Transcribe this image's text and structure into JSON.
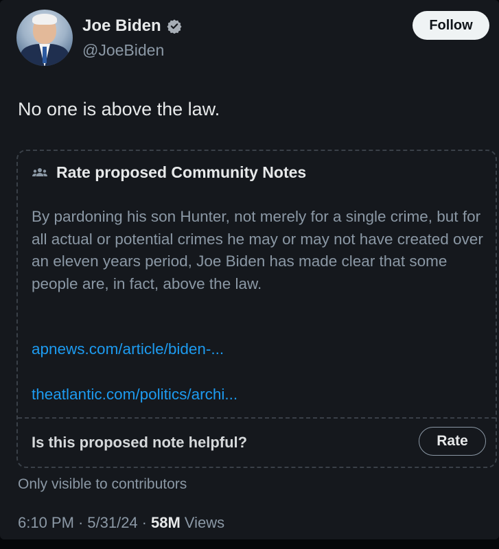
{
  "author": {
    "name": "Joe Biden",
    "handle": "@JoeBiden",
    "verified_icon": "verified-badge-icon",
    "avatar": "profile-photo"
  },
  "follow_label": "Follow",
  "tweet": {
    "text": "No one is above the law."
  },
  "community_notes": {
    "icon": "people-icon",
    "title": "Rate proposed Community Notes",
    "body": "By pardoning his son Hunter, not merely for a single crime, but for all actual or potential crimes he may or may not have created over an eleven years period, Joe Biden has made clear that some people are, in fact, above the law.",
    "links": [
      "apnews.com/article/biden-...",
      "theatlantic.com/politics/archi..."
    ],
    "helpful_question": "Is this proposed note helpful?",
    "rate_label": "Rate"
  },
  "visibility_note": "Only visible to contributors",
  "meta": {
    "time": "6:10 PM",
    "separator": "·",
    "date": "5/31/24",
    "views_count": "58M",
    "views_label": "Views"
  },
  "colors": {
    "background": "#15181d",
    "text": "#e7e9ea",
    "muted": "#8b98a5",
    "link": "#1d9bf0"
  }
}
